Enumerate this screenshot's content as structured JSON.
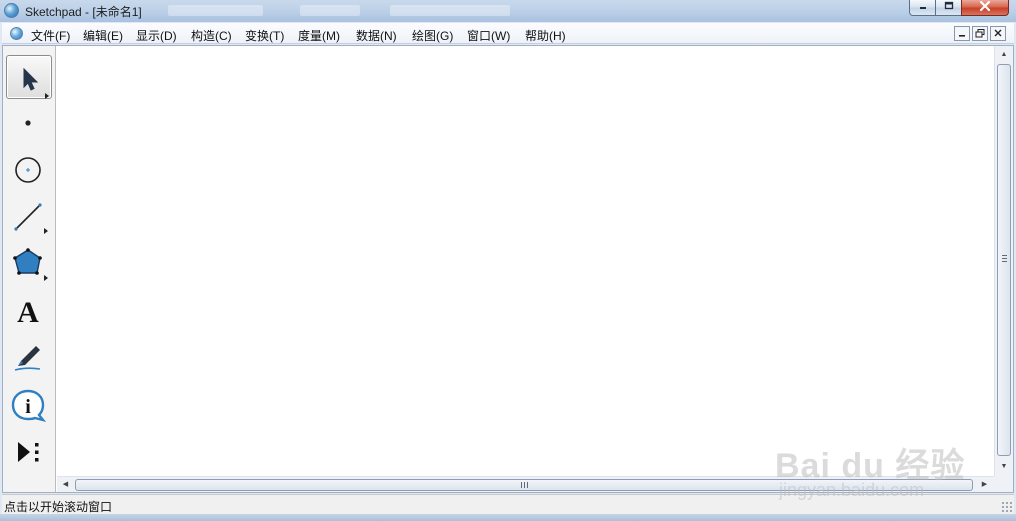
{
  "window": {
    "title": "Sketchpad  - [未命名1]",
    "controls": [
      "minimize",
      "maximize",
      "close"
    ]
  },
  "menu": {
    "items": [
      "文件(F)",
      "编辑(E)",
      "显示(D)",
      "构造(C)",
      "变换(T)",
      "度量(M)",
      "数据(N)",
      "绘图(G)",
      "窗口(W)",
      "帮助(H)"
    ],
    "doc_controls": [
      "minimize",
      "restore",
      "close"
    ]
  },
  "toolbox": {
    "tools": [
      {
        "name": "arrow-tool",
        "icon": "arrow-select-icon",
        "selected": true
      },
      {
        "name": "point-tool",
        "icon": "point-icon",
        "selected": false
      },
      {
        "name": "compass-tool",
        "icon": "circle-icon",
        "selected": false
      },
      {
        "name": "straightedge-tool",
        "icon": "line-segment-icon",
        "selected": false
      },
      {
        "name": "polygon-tool",
        "icon": "polygon-icon",
        "selected": false
      },
      {
        "name": "text-tool",
        "icon": "text-a-icon",
        "selected": false
      },
      {
        "name": "marker-tool",
        "icon": "marker-pen-icon",
        "selected": false
      },
      {
        "name": "information-tool",
        "icon": "info-icon",
        "selected": false
      },
      {
        "name": "custom-tool",
        "icon": "play-dots-icon",
        "selected": false
      }
    ],
    "text_tool_glyph": "A",
    "info_tool_glyph": "i"
  },
  "statusbar": {
    "text": "点击以开始滚动窗口"
  },
  "watermark": {
    "main": "Bai du 经验",
    "sub": "jingyan.baidu.com"
  },
  "colors": {
    "accent": "#2f7fc1",
    "titlebar": "#bcd0e8",
    "close_button": "#c7402a"
  }
}
